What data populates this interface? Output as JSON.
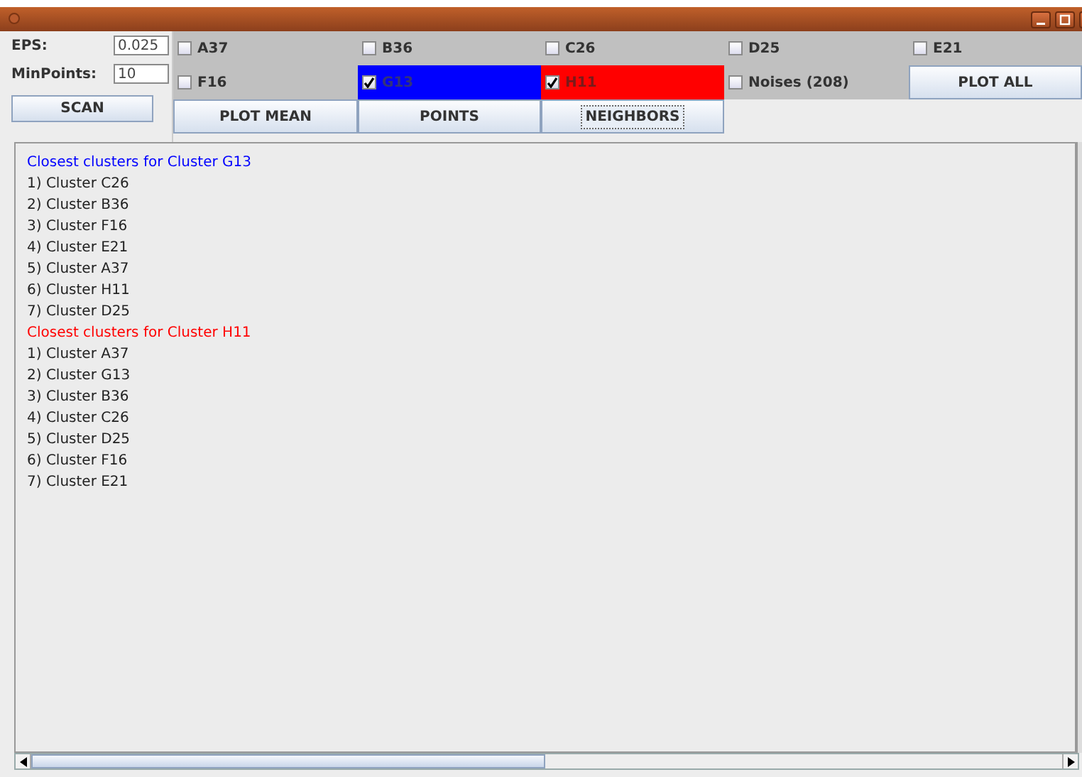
{
  "params": [
    {
      "label": "EPS:",
      "value": "0.025"
    },
    {
      "label": "MinPoints:",
      "value": "10"
    }
  ],
  "scan_button": "SCAN",
  "cells": [
    {
      "kind": "checkbox",
      "label": "A37",
      "checked": false
    },
    {
      "kind": "checkbox",
      "label": "B36",
      "checked": false
    },
    {
      "kind": "checkbox",
      "label": "C26",
      "checked": false
    },
    {
      "kind": "checkbox",
      "label": "D25",
      "checked": false
    },
    {
      "kind": "checkbox",
      "label": "E21",
      "checked": false
    },
    {
      "kind": "checkbox",
      "label": "F16",
      "checked": false
    },
    {
      "kind": "checkbox",
      "label": "G13",
      "checked": true,
      "color": "#0000ff"
    },
    {
      "kind": "checkbox",
      "label": "H11",
      "checked": true,
      "color": "#ff0000"
    },
    {
      "kind": "checkbox",
      "label": "Noises (208)",
      "checked": false
    },
    {
      "kind": "button",
      "label": "PLOT ALL",
      "focused": false
    },
    {
      "kind": "button",
      "label": "PLOT MEAN",
      "focused": false
    },
    {
      "kind": "button",
      "label": "POINTS",
      "focused": false
    },
    {
      "kind": "button",
      "label": "NEIGHBORS",
      "focused": true
    }
  ],
  "output": [
    {
      "kind": "heading",
      "text": "Closest clusters for Cluster G13",
      "color": "#0000ff"
    },
    {
      "kind": "line",
      "text": "1) Cluster C26"
    },
    {
      "kind": "line",
      "text": "2) Cluster B36"
    },
    {
      "kind": "line",
      "text": "3) Cluster F16"
    },
    {
      "kind": "line",
      "text": "4) Cluster E21"
    },
    {
      "kind": "line",
      "text": "5) Cluster A37"
    },
    {
      "kind": "line",
      "text": "6) Cluster H11"
    },
    {
      "kind": "line",
      "text": "7) Cluster D25"
    },
    {
      "kind": "heading",
      "text": "Closest clusters for Cluster H11",
      "color": "#ff0000"
    },
    {
      "kind": "line",
      "text": "1) Cluster A37"
    },
    {
      "kind": "line",
      "text": "2) Cluster G13"
    },
    {
      "kind": "line",
      "text": "3) Cluster B36"
    },
    {
      "kind": "line",
      "text": "4) Cluster C26"
    },
    {
      "kind": "line",
      "text": "5) Cluster D25"
    },
    {
      "kind": "line",
      "text": "6) Cluster F16"
    },
    {
      "kind": "line",
      "text": "7) Cluster E21"
    }
  ]
}
